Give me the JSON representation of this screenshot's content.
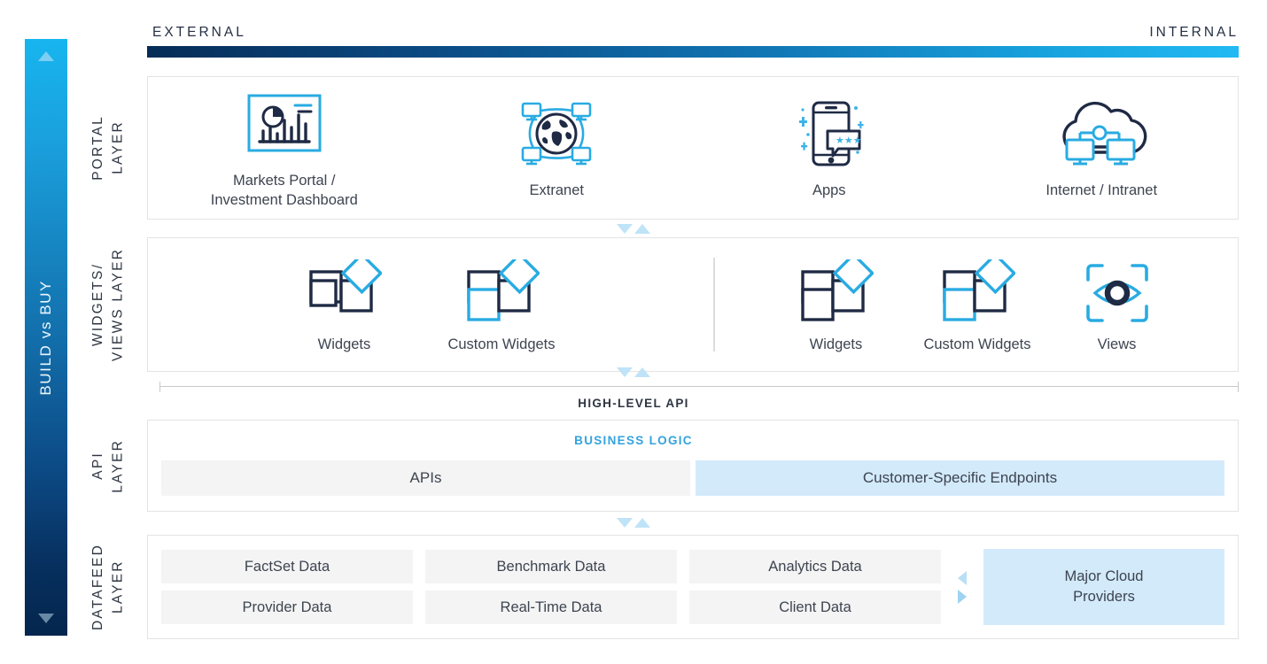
{
  "rail": {
    "label": "BUILD vs BUY",
    "top_arrow": "triangle-up",
    "bottom_arrow": "triangle-down",
    "gradient_from": "#17b5ef",
    "gradient_to": "#04264d"
  },
  "header": {
    "external": "EXTERNAL",
    "internal": "INTERNAL",
    "bar_gradient_from": "#062c57",
    "bar_gradient_to": "#22b9f2"
  },
  "layers": {
    "portal": {
      "label_line1": "PORTAL",
      "label_line2": "LAYER",
      "items": [
        {
          "caption": "Markets Portal /\nInvestment Dashboard",
          "icon": "dashboard-chart-icon"
        },
        {
          "caption": "Extranet",
          "icon": "globe-network-icon"
        },
        {
          "caption": "Apps",
          "icon": "mobile-chat-icon"
        },
        {
          "caption": "Internet / Intranet",
          "icon": "cloud-network-icon"
        }
      ]
    },
    "widgets": {
      "label_line1": "WIDGETS/",
      "label_line2": "VIEWS LAYER",
      "left_items": [
        {
          "caption": "Widgets",
          "icon": "widgets-squares-icon"
        },
        {
          "caption": "Custom Widgets",
          "icon": "custom-widgets-squares-icon"
        }
      ],
      "right_items": [
        {
          "caption": "Widgets",
          "icon": "widgets-squares-icon"
        },
        {
          "caption": "Custom Widgets",
          "icon": "custom-widgets-squares-icon"
        },
        {
          "caption": "Views",
          "icon": "eye-view-icon"
        }
      ]
    },
    "api": {
      "label_line1": "API",
      "label_line2": "LAYER",
      "bracket_label": "HIGH-LEVEL API",
      "business_logic_label": "BUSINESS LOGIC",
      "business_logic_color": "#33a3dd",
      "blocks": [
        {
          "label": "APIs",
          "style": "grey"
        },
        {
          "label": "Customer-Specific Endpoints",
          "style": "blue"
        }
      ]
    },
    "datafeed": {
      "label_line1": "DATAFEED",
      "label_line2": "LAYER",
      "cells": [
        "FactSet Data",
        "Benchmark Data",
        "Analytics Data",
        "Provider Data",
        "Real-Time Data",
        "Client Data"
      ],
      "cloud_block": "Major Cloud\nProviders",
      "cloud_block_color": "#d3eafb"
    }
  },
  "colors": {
    "accent_blue": "#29abe2",
    "dark_navy": "#1f2a44",
    "light_blue_fill": "#d3eafb",
    "grey_fill": "#f4f4f4"
  }
}
